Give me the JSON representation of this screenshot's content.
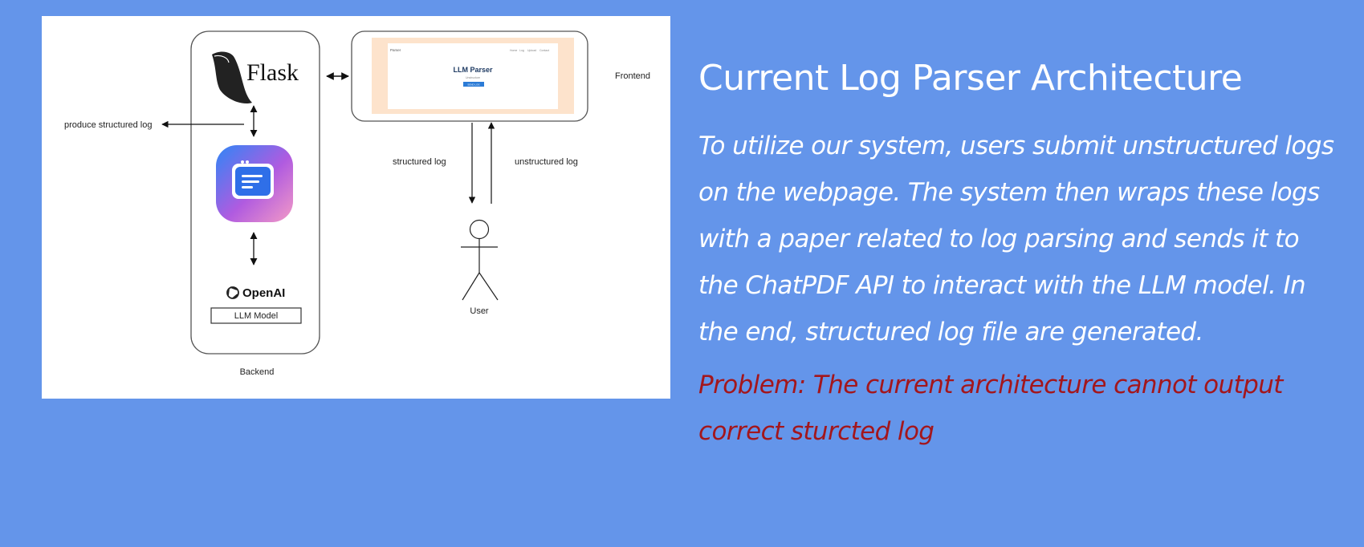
{
  "slide": {
    "title": "Current Log Parser Architecture",
    "body": "To utilize our system, users submit unstructured logs on the webpage. The system then wraps these logs with a paper related to log parsing and sends it to the ChatPDF API to interact with the LLM model. In the end, structured log file are generated.",
    "problem": "Problem: The current architecture cannot output correct sturcted log"
  },
  "diagram": {
    "flask_logo_text": "Flask",
    "openai_logo_text": "OpenAI",
    "llm_model_label": "LLM Model",
    "backend_label": "Backend",
    "frontend_label": "Frontend",
    "produce_label": "produce structured log",
    "structured_label": "structured log",
    "unstructured_label": "unstructured log",
    "user_label": "User",
    "frontend_preview": {
      "brand": "Parser",
      "nav": [
        "Home",
        "Log",
        "Upload",
        "Contact"
      ],
      "title": "LLM Parser",
      "subtitle": "Unstructure",
      "button": "SEND LOG"
    }
  },
  "colors": {
    "background": "#6495ea",
    "problem_text": "#a3161c",
    "frontend_frame": "#fde3cc",
    "chat_icon_gradient": [
      "#2f86f6",
      "#f0a0c8"
    ]
  }
}
